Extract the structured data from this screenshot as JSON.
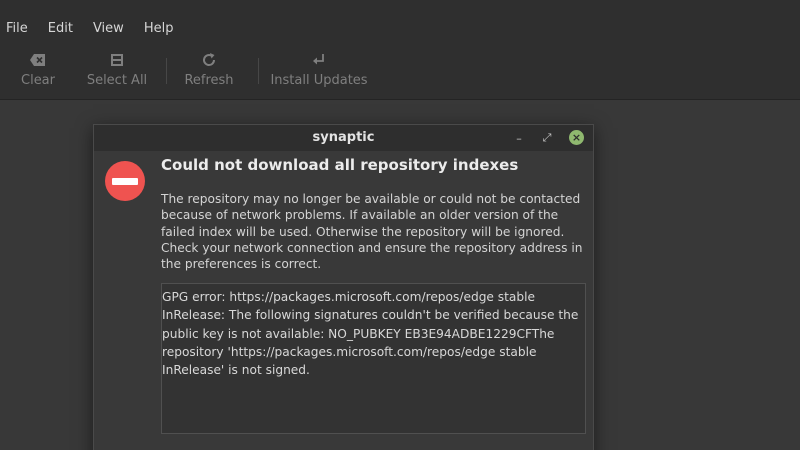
{
  "menubar": {
    "items": [
      "File",
      "Edit",
      "View",
      "Help"
    ]
  },
  "toolbar": {
    "clear_label": "Clear",
    "select_all_label": "Select All",
    "refresh_label": "Refresh",
    "install_updates_label": "Install Updates",
    "icons": {
      "clear": "backspace-icon",
      "select_all": "select-all-icon",
      "refresh": "refresh-icon",
      "install_updates": "return-arrow-icon"
    }
  },
  "dialog": {
    "window_title": "synaptic",
    "minimize_glyph": "–",
    "maximize_glyph": "⤢",
    "close_glyph": "×",
    "icon": "error-icon",
    "heading": "Could not download all repository indexes",
    "description": "The repository may no longer be available or could not be contacted because of network problems. If available an older version of the failed index will be used. Otherwise the repository will be ignored. Check your network connection and ensure the repository address in the preferences is correct.",
    "details": "GPG error: https://packages.microsoft.com/repos/edge stable\nInRelease: The following signatures couldn't be verified because the\npublic key is not available: NO_PUBKEY EB3E94ADBE1229CFThe\nrepository 'https://packages.microsoft.com/repos/edge stable\nInRelease' is not signed."
  },
  "colors": {
    "error_red": "#ef5350",
    "close_green": "#8fb86f",
    "window_bg": "#393939",
    "toolbar_bg": "#2f2f2f"
  }
}
